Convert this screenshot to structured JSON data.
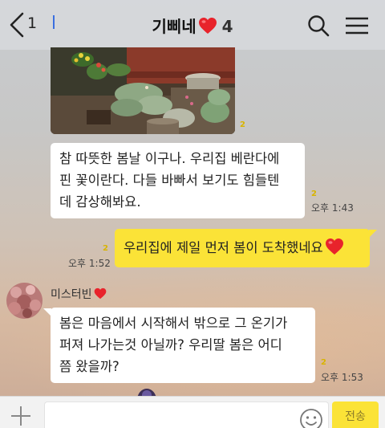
{
  "header": {
    "back_count": "1",
    "title": "기삐네",
    "member_count": "4"
  },
  "messages": [
    {
      "type": "photo",
      "read_count": "2"
    },
    {
      "type": "text",
      "from": "other",
      "lines": [
        "참 따뜻한 봄날 이구나. 우리집 베란다에",
        "핀 꽃이란다. 다들 바빠서 보기도 힘들텐",
        "데 감상해봐요."
      ],
      "read_count": "2",
      "time": "오후 1:43"
    },
    {
      "type": "text",
      "from": "me",
      "text": "우리집에 제일 먼저 봄이 도착했네요",
      "read_count": "2",
      "time": "오후 1:52"
    },
    {
      "type": "text",
      "from": "other",
      "sender": "미스터빈",
      "lines": [
        "봄은 마음에서 시작해서 밖으로 그 온기가",
        "퍼져 나가는것 아닐까? 우리딸 봄은 어디",
        "쯤 왔을까?"
      ],
      "read_count": "2",
      "time": "오후 1:53"
    }
  ],
  "input": {
    "value": "",
    "send_label": "전송"
  },
  "icons": {
    "back": "chevron-left-icon",
    "heart": "heart-icon",
    "search": "search-icon",
    "menu": "hamburger-menu-icon",
    "plus": "plus-icon",
    "emoji": "emoji-icon"
  },
  "colors": {
    "my_bubble": "#fbe337",
    "other_bubble": "#ffffff",
    "heart": "#e8232b",
    "read_count": "#d8b400"
  }
}
